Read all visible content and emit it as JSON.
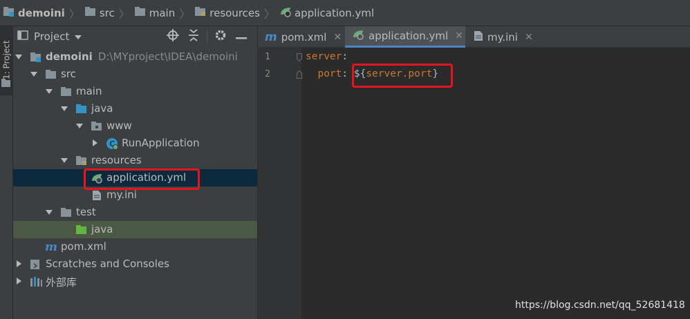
{
  "breadcrumb": [
    "demoini",
    "src",
    "main",
    "resources",
    "application.yml"
  ],
  "sidebar_tab": "1: Project",
  "project_panel": {
    "title": "Project",
    "tree": [
      {
        "label": "demoini",
        "path": "D:\\MYproject\\IDEA\\demoini",
        "icon": "module-folder-icon",
        "level": 0,
        "arrow": "down",
        "bold": true
      },
      {
        "label": "src",
        "icon": "folder-icon",
        "level": 1,
        "arrow": "down"
      },
      {
        "label": "main",
        "icon": "folder-icon",
        "level": 2,
        "arrow": "down"
      },
      {
        "label": "java",
        "icon": "source-folder-icon",
        "level": 3,
        "arrow": "down"
      },
      {
        "label": "www",
        "icon": "package-icon",
        "level": 4,
        "arrow": "down"
      },
      {
        "label": "RunApplication",
        "icon": "spring-boot-class-icon",
        "level": 5,
        "arrow": "right"
      },
      {
        "label": "resources",
        "icon": "resources-folder-icon",
        "level": 3,
        "arrow": "down"
      },
      {
        "label": "application.yml",
        "icon": "spring-yml-icon",
        "level": 4,
        "selected": true
      },
      {
        "label": "my.ini",
        "icon": "file-icon",
        "level": 4
      },
      {
        "label": "test",
        "icon": "folder-icon",
        "level": 2,
        "arrow": "down"
      },
      {
        "label": "java",
        "icon": "test-folder-icon",
        "level": 3,
        "highlight": true
      },
      {
        "label": "pom.xml",
        "icon": "maven-icon",
        "level": 1
      },
      {
        "label": "Scratches and Consoles",
        "icon": "scratches-icon",
        "level": 0,
        "arrow": "right"
      },
      {
        "label": "外部库",
        "icon": "libraries-icon",
        "level": 0,
        "arrow": "right"
      }
    ]
  },
  "editor": {
    "tabs": [
      {
        "label": "pom.xml",
        "icon": "maven-icon",
        "active": false
      },
      {
        "label": "application.yml",
        "icon": "spring-yml-icon",
        "active": true
      },
      {
        "label": "my.ini",
        "icon": "file-icon",
        "active": false
      }
    ],
    "lines": [
      {
        "number": "1",
        "key": "server",
        "colon": ":",
        "value": ""
      },
      {
        "number": "2",
        "key": "  port",
        "colon": ":",
        "value": " ${server.port}"
      }
    ],
    "line2_value_open": "${",
    "line2_value_inner": "server.port",
    "line2_value_close": "}"
  },
  "watermark": "https://blog.csdn.net/qq_52681418",
  "colors": {
    "accent": "#4a88c7",
    "annotation": "#e8161c",
    "key": "#cc7832",
    "selected_row": "#0d293e"
  }
}
